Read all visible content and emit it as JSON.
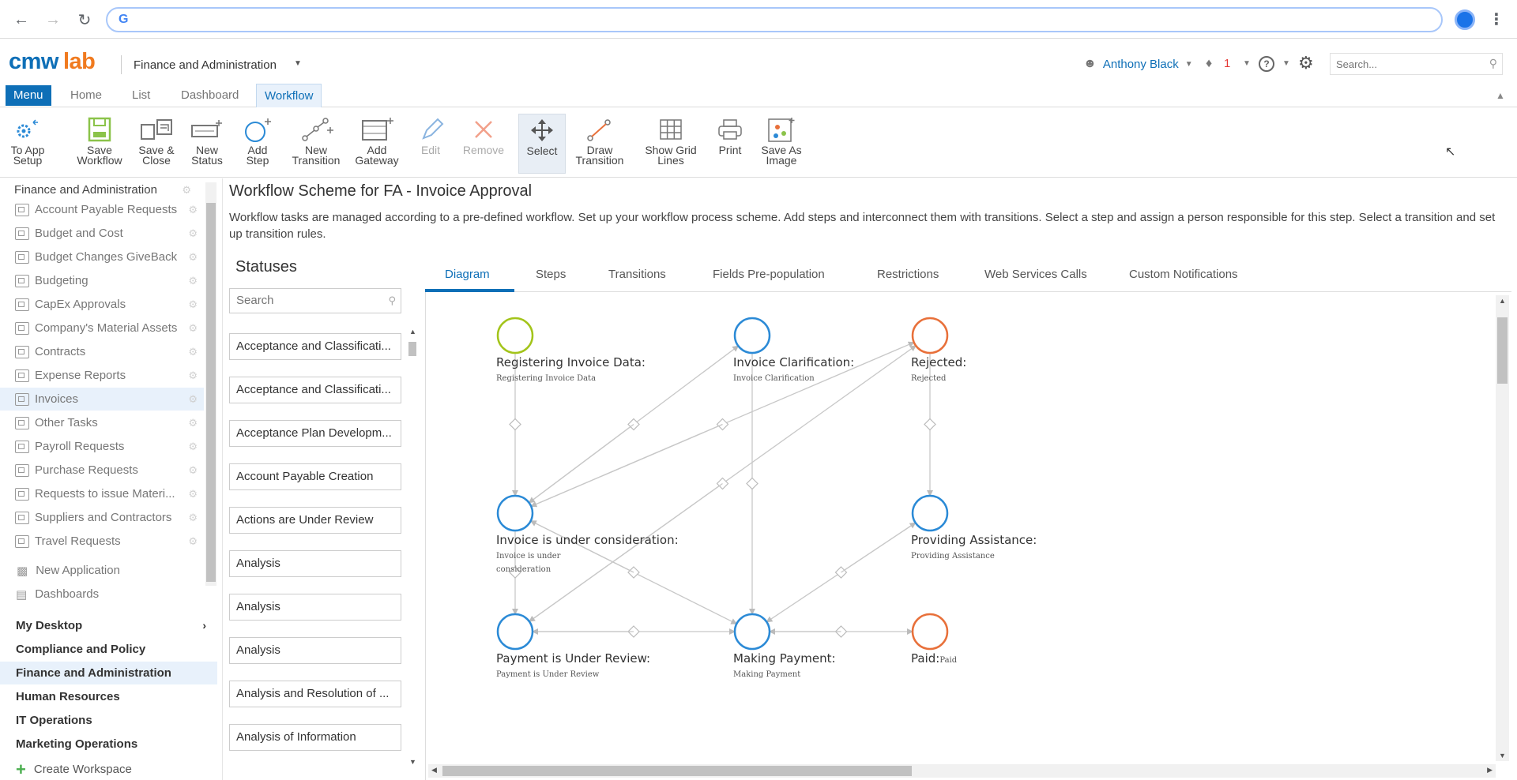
{
  "app": {
    "workspace_title": "Finance and Administration",
    "user_name": "Anthony Black",
    "notification_count": "1",
    "search_placeholder": "Search..."
  },
  "tabs": [
    {
      "label": "Menu"
    },
    {
      "label": "Home"
    },
    {
      "label": "List"
    },
    {
      "label": "Dashboard"
    },
    {
      "label": "Workflow"
    }
  ],
  "toolbar": [
    {
      "line1": "To App",
      "line2": "Setup",
      "icon": "app-setup-icon"
    },
    {
      "line1": "Save",
      "line2": "Workflow",
      "icon": "save-icon"
    },
    {
      "line1": "Save &",
      "line2": "Close",
      "icon": "save-close-icon"
    },
    {
      "line1": "New",
      "line2": "Status",
      "icon": "new-status-icon"
    },
    {
      "line1": "Add",
      "line2": "Step",
      "icon": "add-step-icon"
    },
    {
      "line1": "New",
      "line2": "Transition",
      "icon": "new-transition-icon"
    },
    {
      "line1": "Add",
      "line2": "Gateway",
      "icon": "add-gateway-icon"
    },
    {
      "line1": "Edit",
      "line2": "",
      "icon": "edit-icon"
    },
    {
      "line1": "Remove",
      "line2": "",
      "icon": "remove-icon"
    },
    {
      "line1": "Select",
      "line2": "",
      "icon": "select-icon"
    },
    {
      "line1": "Draw",
      "line2": "Transition",
      "icon": "draw-transition-icon"
    },
    {
      "line1": "Show Grid",
      "line2": "Lines",
      "icon": "grid-icon"
    },
    {
      "line1": "Print",
      "line2": "",
      "icon": "print-icon"
    },
    {
      "line1": "Save As",
      "line2": "Image",
      "icon": "save-image-icon"
    }
  ],
  "sidebar": {
    "top_label": "Finance and Administration",
    "apps": [
      "Account Payable Requests",
      "Budget and Cost",
      "Budget Changes GiveBack",
      "Budgeting",
      "CapEx Approvals",
      "Company's Material Assets",
      "Contracts",
      "Expense Reports",
      "Invoices",
      "Other Tasks",
      "Payroll Requests",
      "Purchase Requests",
      "Requests to issue Materi...",
      "Suppliers and Contractors",
      "Travel Requests"
    ],
    "new_application": "New Application",
    "dashboards": "Dashboards",
    "sections": [
      "My Desktop",
      "Compliance and Policy",
      "Finance and Administration",
      "Human Resources",
      "IT Operations",
      "Marketing Operations"
    ],
    "create_workspace": "Create Workspace"
  },
  "main": {
    "title": "Workflow Scheme for FA - Invoice Approval",
    "description": "Workflow tasks are managed according to a pre-defined workflow. Set up your workflow process scheme. Add steps and interconnect them with transitions. Select a step and assign a person responsible for this step. Select a transition and set up transition rules."
  },
  "statuses": {
    "title": "Statuses",
    "search_placeholder": "Search",
    "items": [
      "Acceptance and Classificati...",
      "Acceptance and Classificati...",
      "Acceptance Plan Developm...",
      "Account Payable Creation",
      "Actions are Under Review",
      "Analysis",
      "Analysis",
      "Analysis",
      "Analysis and Resolution of ...",
      "Analysis of Information"
    ]
  },
  "diagram_tabs": [
    "Diagram",
    "Steps",
    "Transitions",
    "Fields Pre-population",
    "Restrictions",
    "Web Services Calls",
    "Custom Notifications"
  ],
  "diagram": {
    "nodes": [
      {
        "id": "reg",
        "title": "Registering Invoice Data:",
        "sub": [
          "Registering Invoice Data"
        ],
        "color": "#a3c41a"
      },
      {
        "id": "clar",
        "title": "Invoice Clarification:",
        "sub": [
          "Invoice Clarification"
        ],
        "color": "#2b8ad6"
      },
      {
        "id": "rej",
        "title": "Rejected:",
        "sub": [
          "Rejected"
        ],
        "color": "#e8703a"
      },
      {
        "id": "cons",
        "title": "Invoice is under consideration:",
        "sub": [
          "Invoice is under",
          "consideration"
        ],
        "color": "#2b8ad6"
      },
      {
        "id": "assist",
        "title": "Providing Assistance:",
        "sub": [
          "Providing Assistance"
        ],
        "color": "#2b8ad6"
      },
      {
        "id": "review",
        "title": "Payment is Under Review:",
        "sub": [
          "Payment is Under Review"
        ],
        "color": "#2b8ad6"
      },
      {
        "id": "pay",
        "title": "Making Payment:",
        "sub": [
          "Making Payment"
        ],
        "color": "#2b8ad6"
      },
      {
        "id": "paid",
        "title": "Paid:",
        "sub_inline": "Paid",
        "color": "#e8703a"
      }
    ]
  }
}
